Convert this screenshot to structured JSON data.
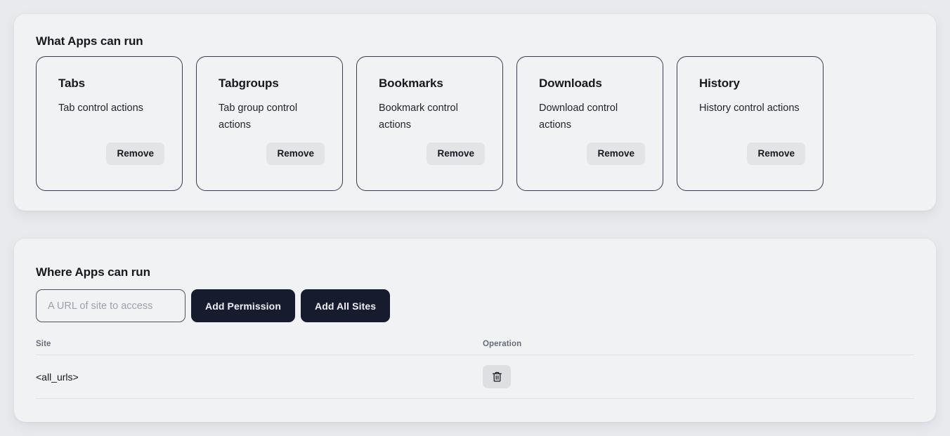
{
  "colors": {
    "page_background": "#e9eaee",
    "panel_background": "#f1f2f4",
    "card_border": "#373d50",
    "button_dark": "#161c2d",
    "button_light": "#e3e4e6",
    "text_primary": "#16181e",
    "text_muted": "#666d7a",
    "placeholder": "#9ba0ab",
    "divider": "#dfe1e5"
  },
  "apps_section": {
    "title": "What Apps can run",
    "cards": [
      {
        "title": "Tabs",
        "description": "Tab control actions",
        "remove_label": "Remove"
      },
      {
        "title": "Tabgroups",
        "description": "Tab group control actions",
        "remove_label": "Remove"
      },
      {
        "title": "Bookmarks",
        "description": "Bookmark control actions",
        "remove_label": "Remove"
      },
      {
        "title": "Downloads",
        "description": "Download control actions",
        "remove_label": "Remove"
      },
      {
        "title": "History",
        "description": "History control actions",
        "remove_label": "Remove"
      }
    ]
  },
  "sites_section": {
    "title": "Where Apps can run",
    "url_input": {
      "value": "",
      "placeholder": "A URL of site to access"
    },
    "add_permission_label": "Add Permission",
    "add_all_sites_label": "Add All Sites",
    "table": {
      "columns": [
        "Site",
        "Operation"
      ],
      "rows": [
        {
          "site": "<all_urls>",
          "operation_icon": "trash-icon"
        }
      ]
    }
  }
}
